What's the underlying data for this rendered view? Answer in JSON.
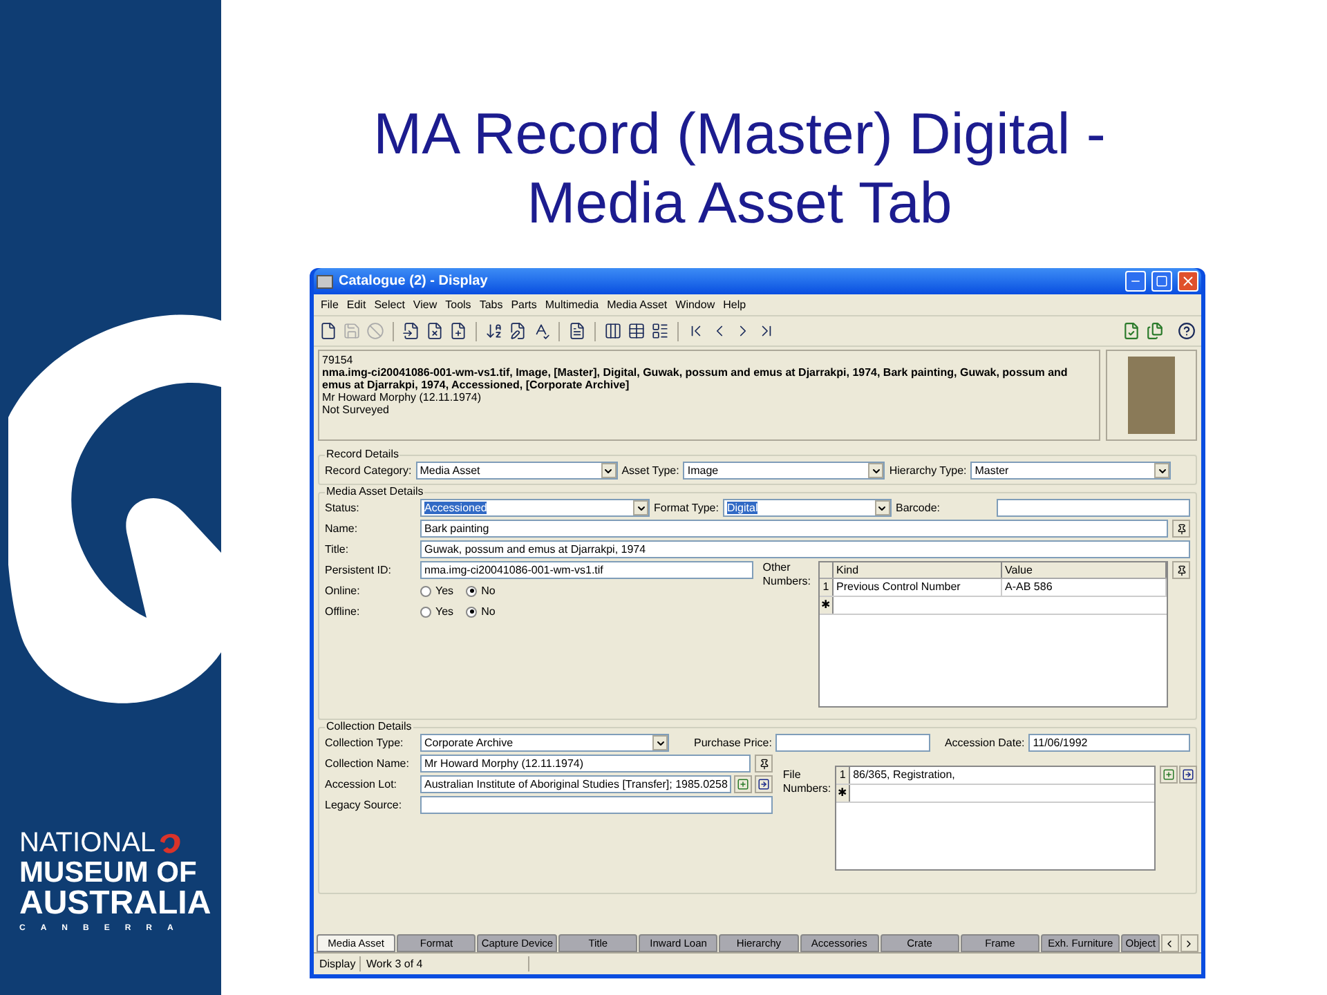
{
  "slide": {
    "title_lines": [
      "MA Record (Master) Digital -",
      "Media Asset Tab"
    ],
    "logo": {
      "lines": [
        "NATIONAL",
        "MUSEUM OF",
        "AUSTRALIA"
      ],
      "city": "CANBERRA"
    }
  },
  "window": {
    "title": "Catalogue (2) - Display",
    "menu": [
      "File",
      "Edit",
      "Select",
      "View",
      "Tools",
      "Tabs",
      "Parts",
      "Multimedia",
      "Media Asset",
      "Window",
      "Help"
    ],
    "summary": [
      {
        "text": "79154",
        "bold": false
      },
      {
        "text": "nma.img-ci20041086-001-wm-vs1.tif, Image, [Master], Digital, Guwak, possum and emus at Djarrakpi, 1974, Bark painting, Guwak, possum and emus at Djarrakpi, 1974, Accessioned, [Corporate Archive]",
        "bold": true
      },
      {
        "text": "Mr Howard Morphy (12.11.1974)",
        "bold": false
      },
      {
        "text": "Not Surveyed",
        "bold": false
      }
    ],
    "record_details": {
      "title": "Record Details",
      "fields": [
        {
          "label": "Record Category:",
          "value": "Media Asset"
        },
        {
          "label": "Asset Type:",
          "value": "Image"
        },
        {
          "label": "Hierarchy Type:",
          "value": "Master"
        }
      ]
    },
    "media_asset_details": {
      "title": "Media Asset Details",
      "status": {
        "label": "Status:",
        "value": "Accessioned",
        "highlighted": true
      },
      "format_type": {
        "label": "Format Type:",
        "value": "Digital",
        "highlighted": true
      },
      "barcode": {
        "label": "Barcode:"
      },
      "name": {
        "label": "Name:",
        "value": "Bark painting"
      },
      "title_field": {
        "label": "Title:",
        "value": "Guwak, possum and emus at Djarrakpi, 1974"
      },
      "persistent_id": {
        "label": "Persistent ID:",
        "value": "nma.img-ci20041086-001-wm-vs1.tif"
      },
      "radios": [
        {
          "label": "Online:",
          "options": [
            {
              "label": "Yes",
              "selected": false
            },
            {
              "label": "No",
              "selected": true
            }
          ]
        },
        {
          "label": "Offline:",
          "options": [
            {
              "label": "Yes",
              "selected": false
            },
            {
              "label": "No",
              "selected": true
            }
          ]
        }
      ],
      "other_numbers": {
        "label": "Other Numbers:",
        "columns": [
          "Kind",
          "Value"
        ],
        "rows": [
          {
            "number": "1",
            "cells": [
              "Previous Control Number",
              "A-AB 586"
            ]
          }
        ],
        "new_row_marker": "✱"
      }
    },
    "collection_details": {
      "title": "Collection Details",
      "collection_type": {
        "label": "Collection Type:",
        "value": "Corporate Archive"
      },
      "purchase_price": {
        "label": "Purchase Price:"
      },
      "accession_date": {
        "label": "Accession Date:",
        "value": "11/06/1992"
      },
      "collection_name": {
        "label": "Collection Name:",
        "value": "Mr Howard Morphy (12.11.1974)"
      },
      "accession_lot": {
        "label": "Accession Lot:",
        "value": "Australian Institute of Aboriginal Studies [Transfer]; 1985.0258"
      },
      "legacy_source": {
        "label": "Legacy Source:"
      },
      "file_numbers": {
        "label": "File Numbers:",
        "rows": [
          {
            "number": "1",
            "value": "86/365, Registration,"
          }
        ],
        "new_row_marker": "✱"
      }
    },
    "tabs": [
      {
        "label": "Media Asset",
        "selected": true
      },
      {
        "label": "Format",
        "selected": false
      },
      {
        "label": "Capture Device",
        "selected": false
      },
      {
        "label": "Title",
        "selected": false
      },
      {
        "label": "Inward Loan",
        "selected": false
      },
      {
        "label": "Hierarchy",
        "selected": false
      },
      {
        "label": "Accessories",
        "selected": false
      },
      {
        "label": "Crate",
        "selected": false
      },
      {
        "label": "Frame",
        "selected": false
      },
      {
        "label": "Exh. Furniture",
        "selected": false
      },
      {
        "label": "Object",
        "selected": false
      }
    ],
    "status_bar": [
      "Display",
      "Work 3 of 4"
    ]
  }
}
